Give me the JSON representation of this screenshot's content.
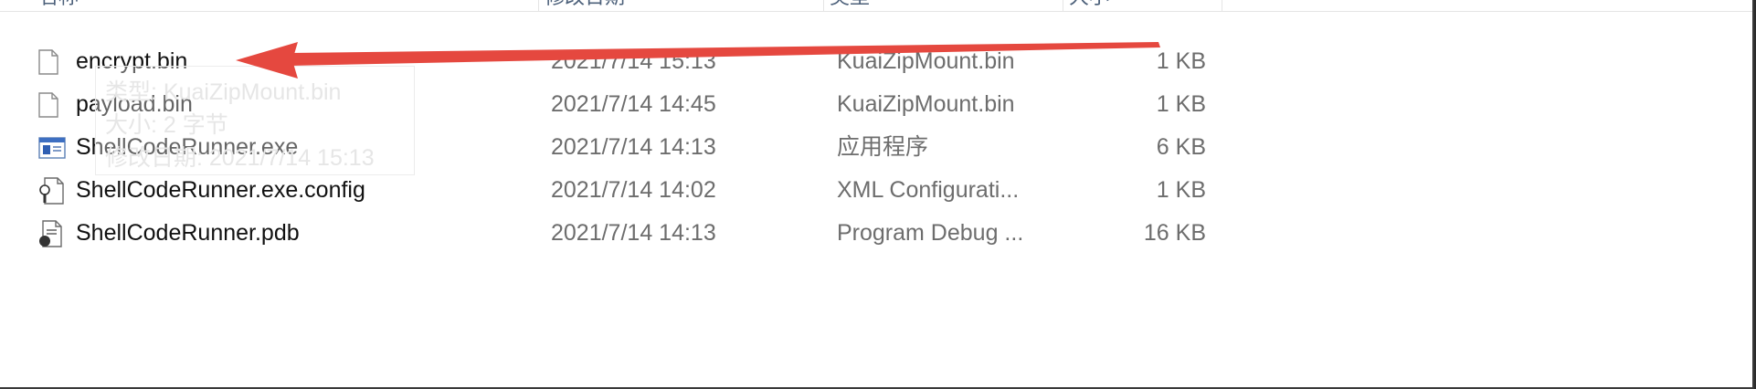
{
  "columns": {
    "name": "名称",
    "date": "修改日期",
    "type": "类型",
    "size": "大小"
  },
  "files": [
    {
      "name": "encrypt.bin",
      "date": "2021/7/14 15:13",
      "type": "KuaiZipMount.bin",
      "size": "1 KB",
      "icon": "blank-file-icon"
    },
    {
      "name": "payload.bin",
      "date": "2021/7/14 14:45",
      "type": "KuaiZipMount.bin",
      "size": "1 KB",
      "icon": "blank-file-icon"
    },
    {
      "name": "ShellCodeRunner.exe",
      "date": "2021/7/14 14:13",
      "type": "应用程序",
      "size": "6 KB",
      "icon": "application-icon"
    },
    {
      "name": "ShellCodeRunner.exe.config",
      "date": "2021/7/14 14:02",
      "type": "XML Configurati...",
      "size": "1 KB",
      "icon": "config-file-icon"
    },
    {
      "name": "ShellCodeRunner.pdb",
      "date": "2021/7/14 14:13",
      "type": "Program Debug ...",
      "size": "16 KB",
      "icon": "debug-file-icon"
    }
  ],
  "tooltip": {
    "type": "类型: KuaiZipMount.bin",
    "size": "大小: 2 字节",
    "date": "修改日期: 2021/7/14 15:13"
  },
  "annotation": {
    "arrow_color": "#e5483f"
  }
}
